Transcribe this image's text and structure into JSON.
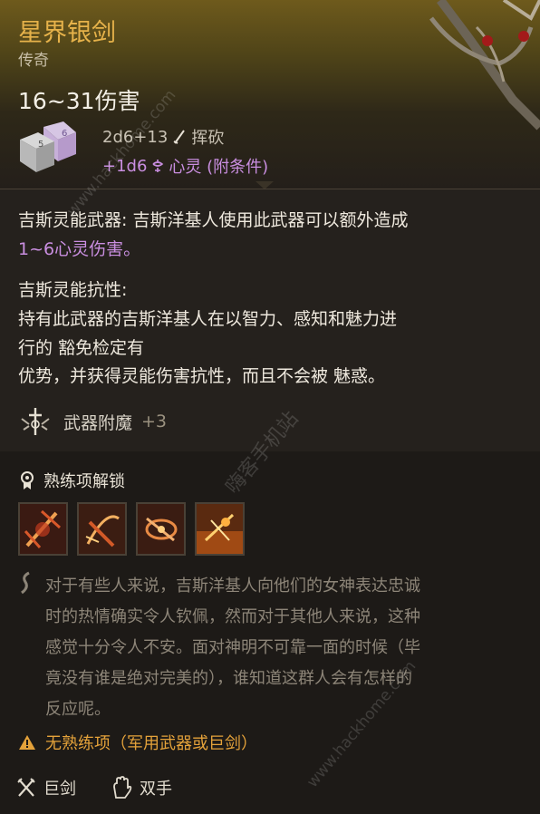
{
  "item": {
    "name": "星界银剑",
    "rarity": "传奇",
    "damage": "16~31伤害",
    "dice_label": "2d6+13",
    "damage_type": "挥砍",
    "bonus_dice": "+1d6",
    "bonus_type": "心灵 (附条件)"
  },
  "description": {
    "p1_title": "吉斯灵能武器:",
    "p1_text": " 吉斯洋基人使用此武器可以额外造成",
    "p1_text2": "1~6心灵伤害。",
    "p2_title": "吉斯灵能抗性:",
    "p2_line1": "持有此武器的吉斯洋基人在以智力、感知和魅力进",
    "p2_line2": "行的 豁免检定有",
    "p2_line3": "优势，并获得灵能伤害抗性，而且不会被 魅惑。"
  },
  "enchant": {
    "label": "武器附魔",
    "value": "+3"
  },
  "proficiency": {
    "title": "熟练项解锁"
  },
  "flavor": {
    "line1": "对于有些人来说，吉斯洋基人向他们的女神表达忠诚",
    "line2": "时的热情确实令人钦佩，然而对于其他人来说，这种",
    "line3": "感觉十分令人不安。面对神明不可靠一面的时候（毕",
    "line4": "竟没有谁是绝对完美的），谁知道这群人会有怎样的",
    "line5": "反应呢。"
  },
  "warning": {
    "text": "无熟练项（军用武器或巨剑）"
  },
  "footer": {
    "weapon_type": "巨剑",
    "handed": "双手"
  },
  "watermark": {
    "text1": "www.hackhome.com",
    "text2": "嗨客手机站",
    "text3": "www.hackhome.com"
  },
  "colors": {
    "title_gold": "#e6b24a",
    "psychic": "#c98ee0",
    "warning": "#e4a23a"
  },
  "icons": [
    "dice-icon",
    "slash-icon",
    "psychic-icon",
    "enchant-icon",
    "proficiency-icon",
    "skill-icon-1",
    "skill-icon-2",
    "skill-icon-3",
    "skill-icon-4",
    "flavor-icon",
    "warning-icon",
    "greatsword-icon",
    "two-handed-icon"
  ]
}
